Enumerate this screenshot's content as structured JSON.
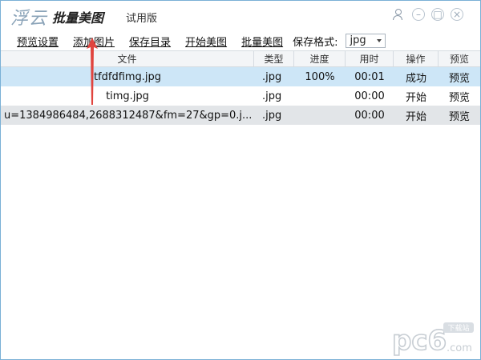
{
  "titlebar": {
    "logo": "浮云",
    "app_name": "批量美图",
    "edition": "试用版",
    "user_icon": "user-icon",
    "minimize_icon": "minimize-icon",
    "maximize_icon": "maximize-icon",
    "close_icon": "close-icon",
    "min_glyph": "–",
    "max_glyph": "□",
    "close_glyph": "×"
  },
  "toolbar": {
    "preview_settings": "预览设置",
    "add_image": "添加图片",
    "save_dir": "保存目录",
    "start": "开始美图",
    "batch": "批量美图",
    "format_label": "保存格式:",
    "format_value": "jpg"
  },
  "table": {
    "headers": [
      "文件",
      "类型",
      "进度",
      "用时",
      "操作",
      "预览"
    ],
    "rows": [
      {
        "file": "tfdfdfimg.jpg",
        "type": ".jpg",
        "progress": "100%",
        "time": "00:01",
        "op": "成功",
        "preview": "预览"
      },
      {
        "file": "timg.jpg",
        "type": ".jpg",
        "progress": "",
        "time": "00:00",
        "op": "开始",
        "preview": "预览"
      },
      {
        "file": "u=1384986484,2688312487&fm=27&gp=0.j...",
        "type": ".jpg",
        "progress": "",
        "time": "00:00",
        "op": "开始",
        "preview": "预览"
      }
    ]
  },
  "colors": {
    "selected_row": "#cde6f7",
    "gray_row": "#e2e5e8",
    "arrow": "#e0443e"
  },
  "watermark": {
    "text": "pc6",
    "sub": "下载站",
    "domain": ".com"
  }
}
